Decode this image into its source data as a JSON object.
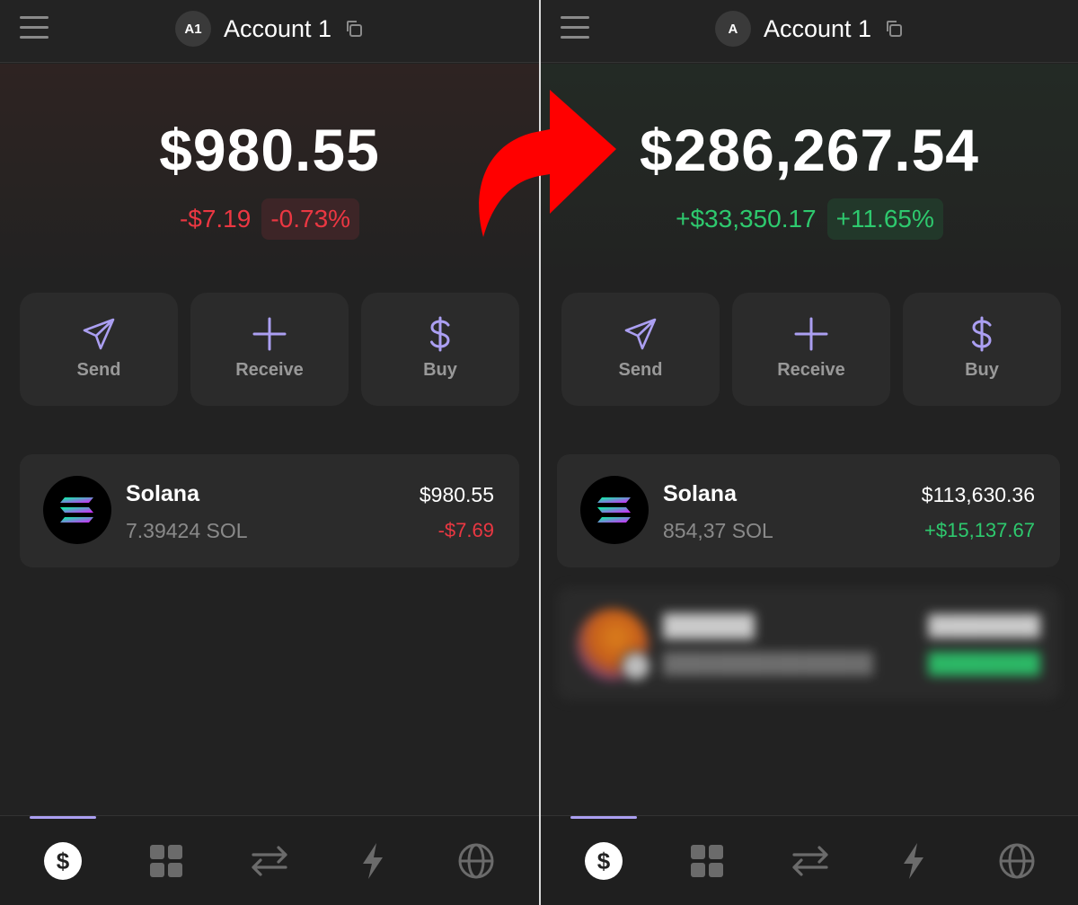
{
  "left": {
    "account": {
      "avatar": "A1",
      "name": "Account 1"
    },
    "balance": "$980.55",
    "change_amount": "-$7.19",
    "change_percent": "-0.73%",
    "actions": [
      {
        "label": "Send",
        "icon": "send-icon"
      },
      {
        "label": "Receive",
        "icon": "plus-icon"
      },
      {
        "label": "Buy",
        "icon": "dollar-icon"
      }
    ],
    "tokens": [
      {
        "name": "Solana",
        "amount": "7.39424 SOL",
        "value": "$980.55",
        "change": "-$7.69"
      }
    ]
  },
  "right": {
    "account": {
      "avatar": "A",
      "name": "Account 1"
    },
    "balance": "$286,267.54",
    "change_amount": "+$33,350.17",
    "change_percent": "+11.65%",
    "actions": [
      {
        "label": "Send",
        "icon": "send-icon"
      },
      {
        "label": "Receive",
        "icon": "plus-icon"
      },
      {
        "label": "Buy",
        "icon": "dollar-icon"
      }
    ],
    "tokens": [
      {
        "name": "Solana",
        "amount": "854,37 SOL",
        "value": "$113,630.36",
        "change": "+$15,137.67"
      }
    ]
  },
  "nav": {
    "items": [
      "wallet-dollar-icon",
      "collectibles-grid-icon",
      "swap-arrows-icon",
      "activity-bolt-icon",
      "explore-globe-icon"
    ],
    "wallet_glyph": "$"
  },
  "colors": {
    "accent": "#ab9ff2",
    "negative": "#eb3742",
    "positive": "#2ec96e",
    "background": "#222222",
    "card": "#2b2b2b",
    "arrow": "#ff0000"
  }
}
